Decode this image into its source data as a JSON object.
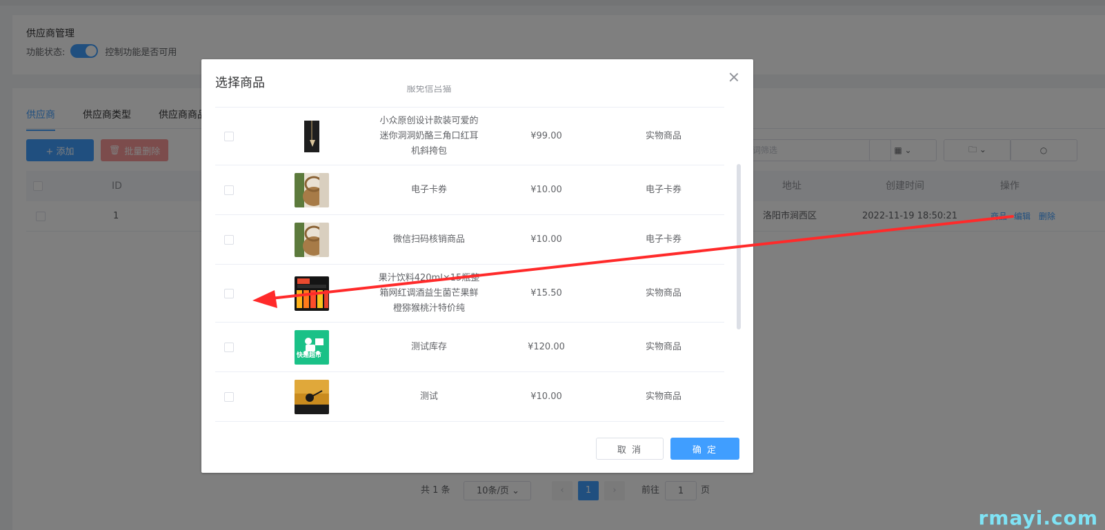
{
  "page": {
    "title": "供应商管理",
    "status_label": "功能状态:",
    "status_desc": "控制功能是否可用",
    "tabs": [
      "供应商",
      "供应商类型",
      "供应商商品"
    ],
    "add_label": "+ 添加",
    "batch_delete_label": "批量删除",
    "filter_placeholder": "键词筛选",
    "table": {
      "headers": {
        "id": "ID",
        "address": "地址",
        "created": "创建时间",
        "actions": "操作"
      },
      "row": {
        "id": "1",
        "address": "洛阳市涧西区",
        "created": "2022-11-19 18:50:21",
        "op_goods": "商品",
        "op_edit": "编辑",
        "op_delete": "删除"
      }
    },
    "pager": {
      "total": "共 1 条",
      "size": "10条/页",
      "current": "1",
      "goto_label": "前往",
      "goto_value": "1",
      "page_unit": "页"
    }
  },
  "dialog": {
    "title": "选择商品",
    "partial_top": "服免信吕猫",
    "products": [
      {
        "name": "小众原创设计款装可爱的迷你洞洞奶酪三角口红耳机斜挎包",
        "name_lines": [
          "小众原创设计款装可爱的",
          "迷你洞洞奶酪三角口红耳",
          "机斜挎包"
        ],
        "price": "¥99.00",
        "type": "实物商品",
        "thumb_icon": "bag-image"
      },
      {
        "name": "电子卡券",
        "name_lines": [
          "电子卡券"
        ],
        "price": "¥10.00",
        "type": "电子卡券",
        "thumb_icon": "basket-image"
      },
      {
        "name": "微信扫码核销商品",
        "name_lines": [
          "微信扫码核销商品"
        ],
        "price": "¥10.00",
        "type": "电子卡券",
        "thumb_icon": "basket-image"
      },
      {
        "name": "果汁饮料420ml×15瓶整箱网红调酒益生菌芒果鲜橙猕猴桃汁特价纯",
        "name_lines": [
          "果汁饮料420ml×15瓶整",
          "箱网红调酒益生菌芒果鲜",
          "橙猕猴桃汁特价纯"
        ],
        "price": "¥15.50",
        "type": "实物商品",
        "thumb_icon": "juice-image"
      },
      {
        "name": "测试库存",
        "name_lines": [
          "测试库存"
        ],
        "price": "¥120.00",
        "type": "实物商品",
        "thumb_icon": "delivery-logo-image",
        "thumb_text": "快递超市"
      },
      {
        "name": "测试",
        "name_lines": [
          "测试"
        ],
        "price": "¥10.00",
        "type": "实物商品",
        "thumb_icon": "sunset-image"
      }
    ],
    "cancel_label": "取 消",
    "ok_label": "确 定"
  },
  "watermark": "rmayi.com",
  "colors": {
    "primary": "#409eff",
    "danger_light": "#f89898",
    "annotation_arrow": "#ff2a2a",
    "watermark": "#7fe3f5"
  }
}
